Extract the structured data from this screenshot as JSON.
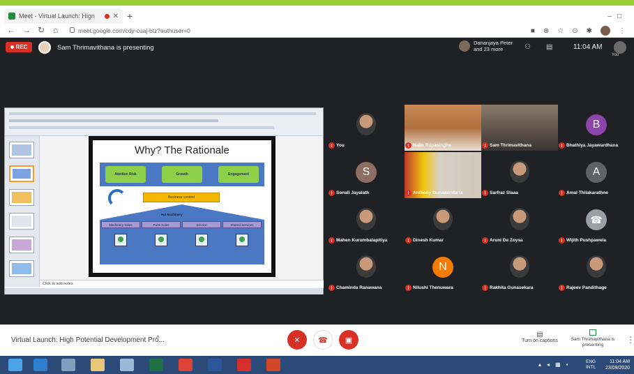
{
  "browser": {
    "tab_title": "Meet - Virtual Launch: Hign",
    "url": "meet.google.com/cdy-cuaj-btz?authuser=0"
  },
  "meet": {
    "rec_label": "REC",
    "presenting_text": "Sam Thrimavithana is presenting",
    "participants_text": "Dananjaya Peter and 23 more",
    "time": "11:04 AM",
    "you_label": "You"
  },
  "slide": {
    "title": "Why? The Rationale",
    "pills": [
      "Attrition Risk",
      "Growth",
      "Engagement"
    ],
    "business_context": "Business context",
    "machinery": "Hpl Machinery",
    "services": [
      "Machinery Sales",
      "Parts Sales",
      "Service",
      "Shared Services"
    ],
    "notes_placeholder": "Click to add notes"
  },
  "participants": [
    {
      "name": "You",
      "type": "photo"
    },
    {
      "name": "Nalin Rupasinghe",
      "type": "video"
    },
    {
      "name": "Sam Thrimavithana",
      "type": "video"
    },
    {
      "name": "Bhathiya Jayawardhana",
      "type": "letter",
      "letter": "B",
      "color": "#8e44ad"
    },
    {
      "name": "Sonali Jayalath",
      "type": "letter",
      "letter": "S",
      "color": "#8d6e63"
    },
    {
      "name": "Anthony Gunawardana",
      "type": "video"
    },
    {
      "name": "Sarfraz Slaaa",
      "type": "photo"
    },
    {
      "name": "Amal Thilakarathne",
      "type": "letter",
      "letter": "A",
      "color": "#5f6368"
    },
    {
      "name": "Mahen Kurumbalapitiya",
      "type": "photo"
    },
    {
      "name": "Dinesh Kumar",
      "type": "photo"
    },
    {
      "name": "Aruni De Zoysa",
      "type": "photo"
    },
    {
      "name": "Wijith Pushpawela",
      "type": "letter",
      "letter": "☎",
      "color": "#9aa0a6"
    },
    {
      "name": "Chaminda Ranawana",
      "type": "photo"
    },
    {
      "name": "Nilushi Thenuwara",
      "type": "letter",
      "letter": "N",
      "color": "#f57c00"
    },
    {
      "name": "Rakhita Gunasekara",
      "type": "photo"
    },
    {
      "name": "Rajeev Pandithage",
      "type": "photo"
    }
  ],
  "bottom": {
    "meeting_title": "Virtual Launch: High Potential Development Pro...",
    "captions_label": "Turn on captions",
    "presenting_label": "Sam Thrimavithana is presenting"
  },
  "taskbar": {
    "lang_line1": "ENG",
    "lang_line2": "INTL",
    "time": "11:04 AM",
    "date": "23/09/2020"
  }
}
